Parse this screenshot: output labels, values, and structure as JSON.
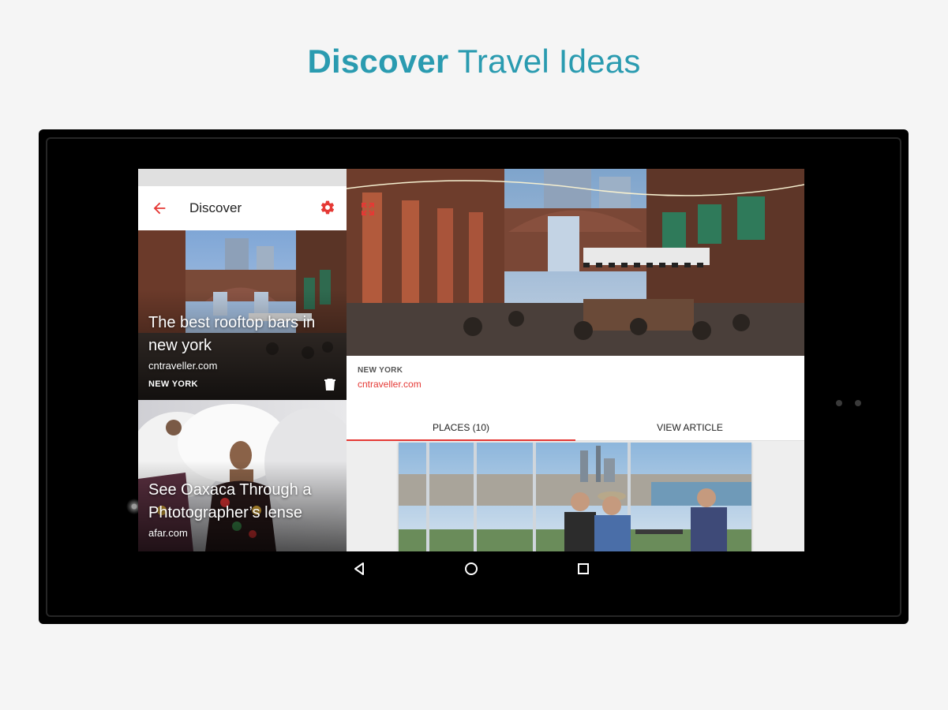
{
  "headline": {
    "strong": "Discover",
    "light": "Travel Ideas"
  },
  "colors": {
    "accent": "#e53935",
    "headline": "#2a9bb0"
  },
  "toolbar": {
    "title": "Discover",
    "back_icon": "arrow-back-icon",
    "settings_icon": "gear-icon"
  },
  "feed": [
    {
      "title": "The best rooftop bars in new york",
      "source": "cntraveller.com",
      "tag": "NEW YORK"
    },
    {
      "title": "See Oaxaca Through a Phtotographer’s lense",
      "source": "afar.com"
    }
  ],
  "detail": {
    "city": "NEW YORK",
    "source": "cntraveller.com",
    "tabs": [
      "PLACES (10)",
      "VIEW ARTICLE"
    ],
    "selected_tab": "PLACES (10)"
  },
  "navbar": {
    "back": "back-icon",
    "home": "home-icon",
    "recents": "recents-icon"
  }
}
